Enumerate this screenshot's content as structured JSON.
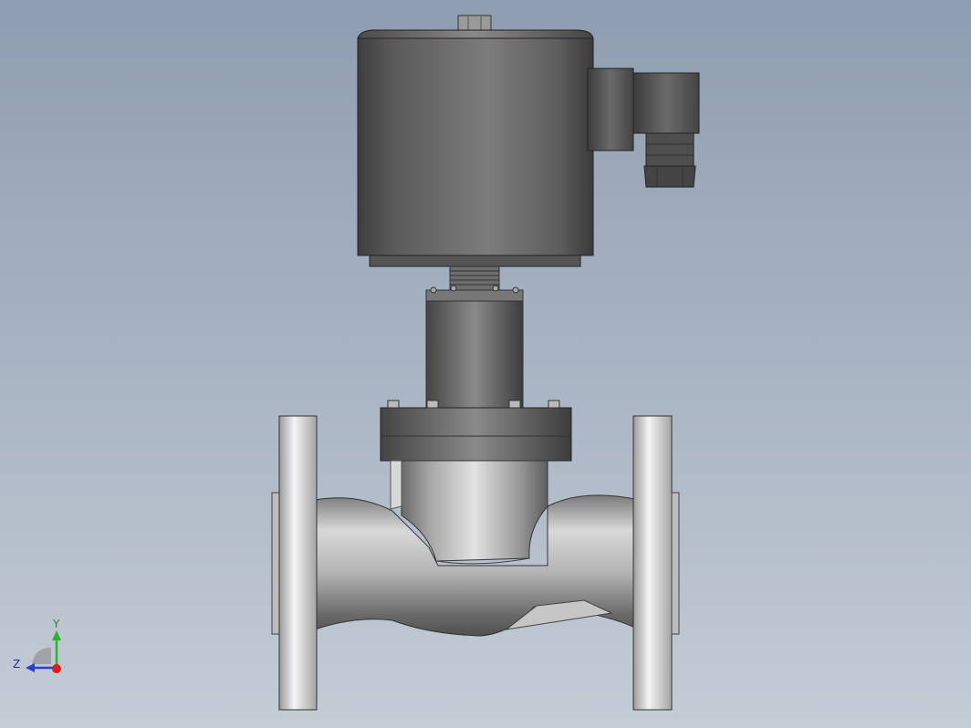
{
  "viewport": {
    "background_top": "#8e9db0",
    "background_bottom": "#c4ccd6"
  },
  "model": {
    "description_icon": "solenoid-valve-3d-model",
    "colors": {
      "coil": "#6e6e6e",
      "coil_dark": "#4a4a4a",
      "body_steel": "#c9c9c9",
      "body_steel_dark": "#8a8a8a",
      "flange_face": "#e6e6e6"
    }
  },
  "triad": {
    "y_label": "Y",
    "z_label": "Z",
    "colors": {
      "y": "#2bb52b",
      "z": "#2a3fc9",
      "x": "#d61f1f"
    }
  }
}
